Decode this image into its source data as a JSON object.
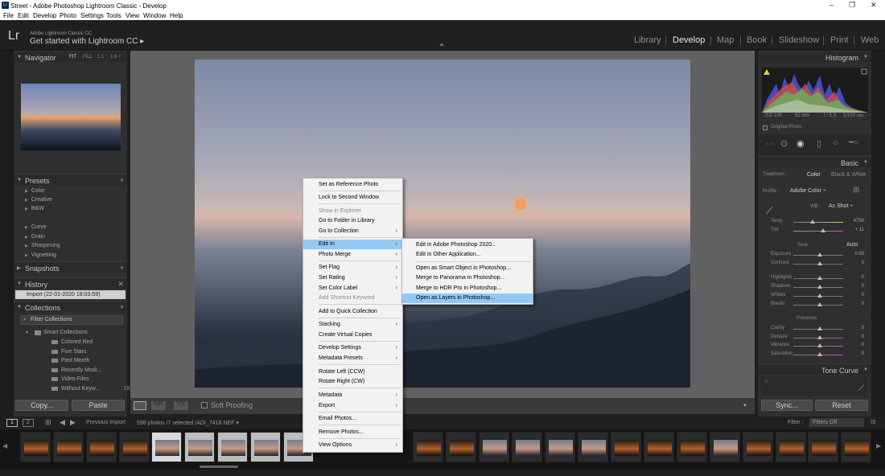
{
  "window": {
    "title": "Street - Adobe Photoshop Lightroom Classic - Develop",
    "min": "–",
    "max": "❐",
    "close": "✕"
  },
  "menubar": [
    "File",
    "Edit",
    "Develop",
    "Photo",
    "Settings",
    "Tools",
    "View",
    "Window",
    "Help"
  ],
  "identity": {
    "logo": "Lr",
    "sub": "Adobe Lightroom Classic CC",
    "main": "Get started with Lightroom CC ▸"
  },
  "modules": [
    "Library",
    "Develop",
    "Map",
    "Book",
    "Slideshow",
    "Print",
    "Web"
  ],
  "active_module": "Develop",
  "left": {
    "navigator": {
      "title": "Navigator",
      "modes": [
        "FIT",
        "FILL",
        "1:1",
        "1:8 ÷"
      ]
    },
    "presets": {
      "title": "Presets",
      "items": [
        "Color",
        "Creative",
        "B&W",
        "Curve",
        "Grain",
        "Sharpening",
        "Vignetting"
      ]
    },
    "snapshots": {
      "title": "Snapshots"
    },
    "history": {
      "title": "History",
      "entry": "Import (22-01-2020 18:03:59)"
    },
    "collections": {
      "title": "Collections",
      "filter": "Filter Collections",
      "smart": "Smart Collections",
      "items": [
        {
          "name": "Colored Red",
          "count": "0"
        },
        {
          "name": "Five Stars",
          "count": "0"
        },
        {
          "name": "Past Month",
          "count": "0"
        },
        {
          "name": "Recently Modi...",
          "count": "0"
        },
        {
          "name": "Video Files",
          "count": "7"
        },
        {
          "name": "Without Keyw...",
          "count": "1832"
        }
      ]
    },
    "copy": "Copy...",
    "paste": "Paste"
  },
  "right": {
    "histogram": {
      "title": "Histogram",
      "iso": "ISO 100",
      "focal": "62 mm",
      "fstop": "f / 5.3",
      "shutter": "1/100 sec",
      "original": "Original Photo"
    },
    "basic": {
      "title": "Basic",
      "treatment_label": "Treatment :",
      "treatment_color": "Color",
      "treatment_bw": "Black & White",
      "profile_label": "Profile :",
      "profile_value": "Adobe Color ÷",
      "wb_label": "WB :",
      "wb_value": "As Shot ÷",
      "temp": {
        "label": "Temp",
        "value": "4750"
      },
      "tint": {
        "label": "Tint",
        "value": "+ 11"
      },
      "tone": "Tone",
      "auto": "Auto",
      "exposure": {
        "label": "Exposure",
        "value": "0.00"
      },
      "contrast": {
        "label": "Contrast",
        "value": "0"
      },
      "highlights": {
        "label": "Highlights",
        "value": "0"
      },
      "shadows": {
        "label": "Shadows",
        "value": "0"
      },
      "whites": {
        "label": "Whites",
        "value": "0"
      },
      "blacks": {
        "label": "Blacks",
        "value": "0"
      },
      "presence": "Presence",
      "clarity": {
        "label": "Clarity",
        "value": "0"
      },
      "dehaze": {
        "label": "Dehaze",
        "value": "0"
      },
      "vibrance": {
        "label": "Vibrance",
        "value": "0"
      },
      "saturation": {
        "label": "Saturation",
        "value": "0"
      }
    },
    "tonecurve": {
      "title": "Tone Curve"
    },
    "sync": "Sync...",
    "reset": "Reset"
  },
  "toolbar": {
    "soft_proofing": "Soft Proofing"
  },
  "filmstrip": {
    "pages": [
      "1",
      "2"
    ],
    "source": "Previous Import",
    "info": "598 photos /7 selected /ADI_7418.NEF ▾",
    "filter_label": "Filter :",
    "filter_value": "Filters Off"
  },
  "context_menu": [
    {
      "label": "Set as Reference Photo"
    },
    {
      "label": "Lock to Second Window"
    },
    {
      "label": "Show in Explorer",
      "disabled": true
    },
    {
      "label": "Go to Folder in Library"
    },
    {
      "label": "Go to Collection",
      "submenu": true
    },
    {
      "label": "Edit In",
      "submenu": true,
      "highlight": true
    },
    {
      "label": "Photo Merge",
      "submenu": true
    },
    {
      "label": "Set Flag",
      "submenu": true
    },
    {
      "label": "Set Rating",
      "submenu": true
    },
    {
      "label": "Set Color Label",
      "submenu": true
    },
    {
      "label": "Add Shortcut Keyword",
      "disabled": true
    },
    {
      "label": "Add to Quick Collection"
    },
    {
      "label": "Stacking",
      "submenu": true
    },
    {
      "label": "Create Virtual Copies"
    },
    {
      "label": "Develop Settings",
      "submenu": true
    },
    {
      "label": "Metadata Presets",
      "submenu": true
    },
    {
      "label": "Rotate Left (CCW)"
    },
    {
      "label": "Rotate Right (CW)"
    },
    {
      "label": "Metadata",
      "submenu": true
    },
    {
      "label": "Export",
      "submenu": true
    },
    {
      "label": "Email Photos..."
    },
    {
      "label": "Remove Photos..."
    },
    {
      "label": "View Options",
      "submenu": true
    }
  ],
  "submenu": [
    {
      "label": "Edit in Adobe Photoshop 2020..."
    },
    {
      "label": "Edit in Other Application..."
    },
    {
      "label": "Open as Smart Object in Photoshop..."
    },
    {
      "label": "Merge to Panorama in Photoshop..."
    },
    {
      "label": "Merge to HDR Pro in Photoshop..."
    },
    {
      "label": "Open as Layers in Photoshop...",
      "highlight": true
    }
  ]
}
